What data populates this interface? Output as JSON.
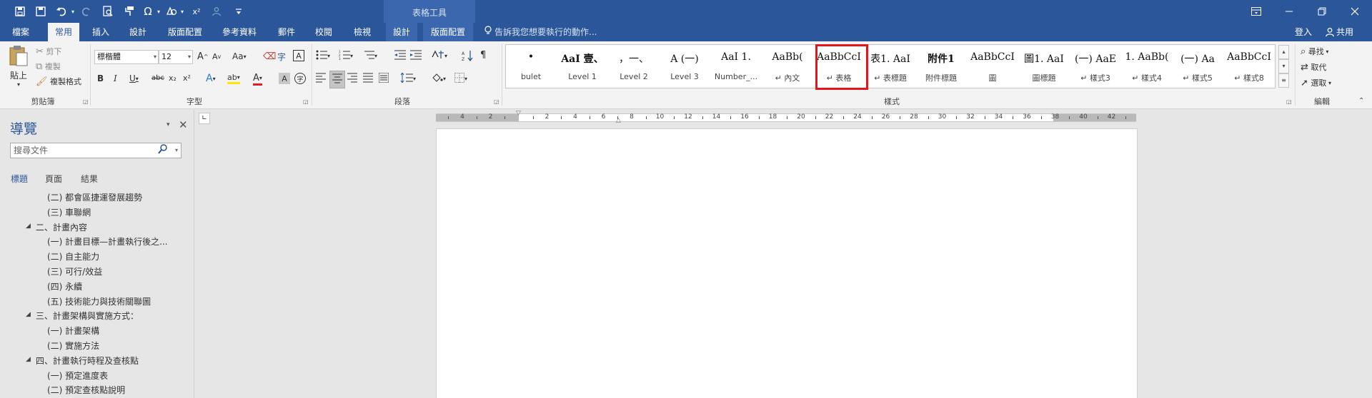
{
  "title_bar": {
    "context_group_title": "表格工具",
    "quick_access": [
      "save-icon",
      "save-as-icon",
      "undo-icon",
      "redo-icon",
      "print-preview-icon",
      "format-painter-icon",
      "omega-icon",
      "shapes-icon",
      "superscript-icon",
      "user-icon",
      "customize-icon"
    ],
    "superscript_label": "x²",
    "omega_label": "Ω",
    "window_buttons": [
      "ribbon-display-options-icon",
      "minimize-icon",
      "restore-icon",
      "close-icon"
    ]
  },
  "tabs": [
    {
      "label": "檔案",
      "active": false
    },
    {
      "label": "常用",
      "active": true
    },
    {
      "label": "插入",
      "active": false
    },
    {
      "label": "設計",
      "active": false
    },
    {
      "label": "版面配置",
      "active": false
    },
    {
      "label": "參考資料",
      "active": false
    },
    {
      "label": "郵件",
      "active": false
    },
    {
      "label": "校閱",
      "active": false
    },
    {
      "label": "檢視",
      "active": false
    },
    {
      "label": "設計",
      "active": false
    },
    {
      "label": "版面配置",
      "active": false
    }
  ],
  "tell_me": "告訴我您想要執行的動作...",
  "account": {
    "sign_in": "登入",
    "share": "共用"
  },
  "ribbon": {
    "clipboard": {
      "paste": "貼上",
      "cut": "剪下",
      "copy": "複製",
      "format_painter": "複製格式",
      "group_label": "剪貼簿"
    },
    "font": {
      "font_name": "標楷體",
      "font_size": "12",
      "grow": "A",
      "shrink": "A",
      "case": "Aa",
      "bold": "B",
      "italic": "I",
      "underline": "U",
      "strike": "abc",
      "subscript": "x₂",
      "superscript": "x²",
      "text_effects": "A",
      "highlight": "ab",
      "font_color": "A",
      "shading": "A",
      "char_border": "A",
      "phonetic": "字",
      "enclose": "字",
      "group_label": "字型"
    },
    "paragraph": {
      "group_label": "段落"
    },
    "styles": {
      "group_label": "樣式",
      "items": [
        {
          "preview": "•",
          "name": "bulet"
        },
        {
          "preview": "AaI 壹、",
          "name": "Level 1"
        },
        {
          "preview": "，一、",
          "name": "Level 2"
        },
        {
          "preview": "A (一)",
          "name": "Level 3"
        },
        {
          "preview": "AaI 1.",
          "name": "Number_..."
        },
        {
          "preview": "AaBb( ",
          "name": "↵ 內文"
        },
        {
          "preview": "AaBbCcI",
          "name": "↵ 表格"
        },
        {
          "preview": "表1. AaI",
          "name": "↵ 表標題"
        },
        {
          "preview": "附件1",
          "name": "附件標題"
        },
        {
          "preview": "AaBbCcI",
          "name": "圖"
        },
        {
          "preview": "圖1. AaI",
          "name": "圖標題"
        },
        {
          "preview": "(一) AaE",
          "name": "↵ 樣式3"
        },
        {
          "preview": "1. AaBb(",
          "name": "↵ 樣式4"
        },
        {
          "preview": "(一) Aa",
          "name": "↵ 樣式5"
        },
        {
          "preview": "AaBbCcI",
          "name": "↵ 樣式8"
        }
      ]
    },
    "editing": {
      "find": "尋找",
      "replace": "取代",
      "select": "選取",
      "group_label": "編輯"
    }
  },
  "nav_pane": {
    "title": "導覽",
    "search_placeholder": "搜尋文件",
    "tabs": [
      "標題",
      "頁面",
      "結果"
    ],
    "active_tab": "標題",
    "items": [
      {
        "text": "(二) 都會區捷運發展趨勢",
        "level": 2,
        "expandable": false
      },
      {
        "text": "(三) 車聯網",
        "level": 2,
        "expandable": false
      },
      {
        "text": "二、計畫內容",
        "level": 1,
        "expandable": true
      },
      {
        "text": "(一) 計畫目標—計畫執行後之...",
        "level": 2,
        "expandable": false
      },
      {
        "text": "(二) 自主能力",
        "level": 2,
        "expandable": false
      },
      {
        "text": "(三) 可行/效益",
        "level": 2,
        "expandable": false
      },
      {
        "text": "(四) 永續",
        "level": 2,
        "expandable": false
      },
      {
        "text": "(五) 技術能力與技術關聯圖",
        "level": 2,
        "expandable": false
      },
      {
        "text": "三、計畫架構與實施方式：",
        "level": 1,
        "expandable": true
      },
      {
        "text": "(一) 計畫架構",
        "level": 2,
        "expandable": false
      },
      {
        "text": "(二) 實施方法",
        "level": 2,
        "expandable": false
      },
      {
        "text": "四、計畫執行時程及查核點",
        "level": 1,
        "expandable": true
      },
      {
        "text": "(一) 預定進度表",
        "level": 2,
        "expandable": false
      },
      {
        "text": "(二) 預定查核點說明",
        "level": 2,
        "expandable": false
      }
    ]
  },
  "ruler": {
    "numbers": [
      "4",
      "2",
      "2",
      "4",
      "6",
      "8",
      "10",
      "12",
      "14",
      "16",
      "18",
      "20",
      "22",
      "24",
      "26",
      "28",
      "30",
      "32",
      "34",
      "36",
      "38",
      "40",
      "42"
    ]
  },
  "colors": {
    "accent": "#2b579a",
    "highlight_box": "#e8141b"
  }
}
